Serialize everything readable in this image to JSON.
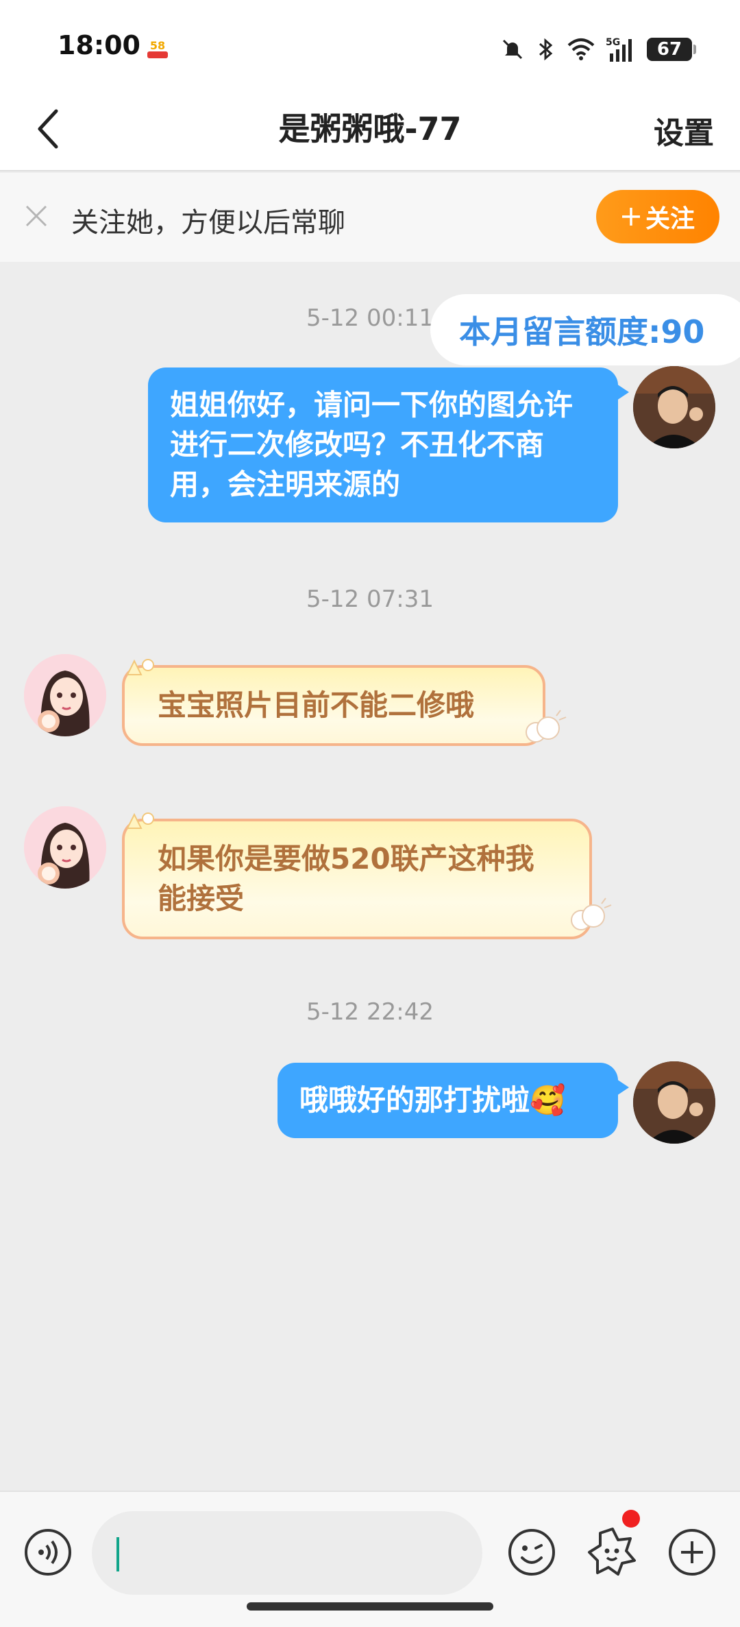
{
  "status_bar": {
    "time": "18:00",
    "app_badge_text": "58",
    "network": "5G",
    "battery": "67",
    "icons": [
      "mute-icon",
      "bluetooth-icon",
      "wifi-icon",
      "signal-icon",
      "battery-icon"
    ]
  },
  "nav": {
    "title": "是粥粥哦-77",
    "settings_label": "设置"
  },
  "follow_bar": {
    "text": "关注她，方便以后常聊",
    "button_label": "关注"
  },
  "chat": {
    "quota": "本月留言额度:90",
    "messages": [
      {
        "time": "5-12 00:11",
        "sender": "me",
        "text": "姐姐你好，请问一下你的图允许进行二次修改吗？不丑化不商用，会注明来源的"
      },
      {
        "time": "5-12 07:31",
        "sender": "her",
        "text": "宝宝照片目前不能二修哦"
      },
      {
        "sender": "her",
        "text": "如果你是要做520联产这种我能接受"
      },
      {
        "time": "5-12 22:42",
        "sender": "me",
        "text": "哦哦好的那打扰啦🥰"
      }
    ]
  },
  "colors": {
    "my_bubble": "#3ea6ff",
    "her_bubble_text": "#b0713c",
    "follow_button": "#ff8c00",
    "quota_text": "#3a8ee6"
  }
}
